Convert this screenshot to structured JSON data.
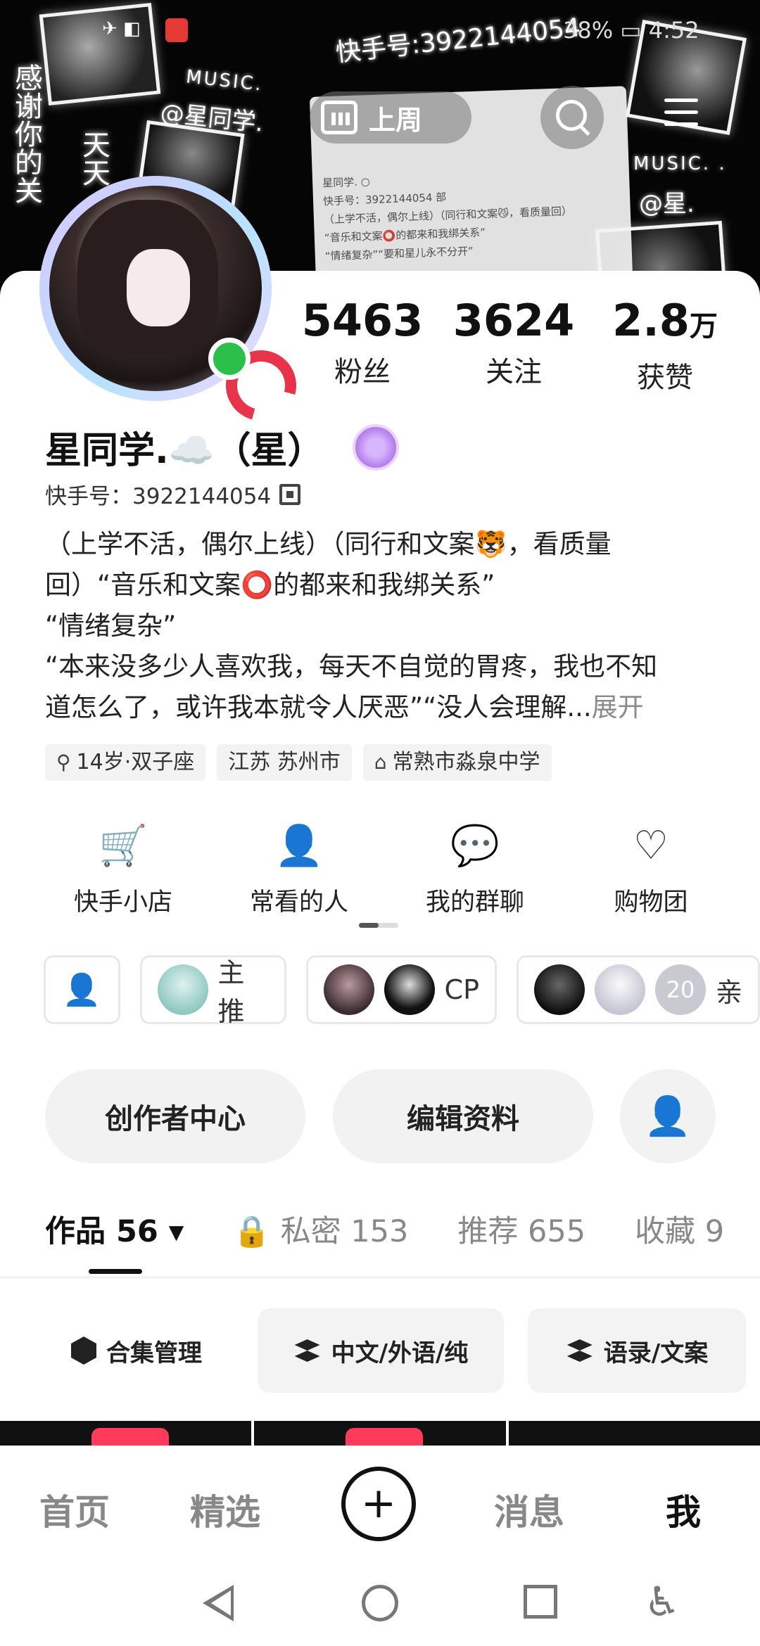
{
  "status_bar": {
    "icons_left": "✈ ◧",
    "battery_time": "38% ▭ 4:52"
  },
  "cover": {
    "vertical_left": "感谢你的关",
    "vertical_second": "天天",
    "music_left": "MUSIC.",
    "at_left": "@星同学.",
    "music_right": "MUSIC. .",
    "at_right": "@星.",
    "kuaishou_id_text": "快手号:3922144054",
    "card_lines": [
      "星同学.  ○",
      "快手号：3922144054 部",
      "（上学不活，偶尔上线）（同行和文案😼，看质量回）",
      "“音乐和文案⭕的都来和我绑关系”",
      "“情绪复杂”“要和星儿永不分开”"
    ]
  },
  "top_bar": {
    "week_label": "上周",
    "search_icon": "search-icon",
    "menu_icon": "menu-icon"
  },
  "profile": {
    "stats": [
      {
        "value": "5463",
        "unit": "",
        "label": "粉丝"
      },
      {
        "value": "3624",
        "unit": "",
        "label": "关注"
      },
      {
        "value": "2.8",
        "unit": "万",
        "label": "获赞"
      }
    ],
    "name": "星同学.☁️（星）",
    "kuaishou_id": "快手号：3922144054",
    "bio_lines": [
      "（上学不活，偶尔上线）（同行和文案🐯，看质量",
      "回）“音乐和文案⭕的都来和我绑关系”",
      "“情绪复杂”",
      "“本来没多少人喜欢我，每天不自觉的胃疼，我也不知",
      "道怎么了，或许我本就令人厌恶”“没人会理解..."
    ],
    "bio_more": "展开",
    "tags": [
      {
        "icon": "⚲",
        "text": "14岁·双子座"
      },
      {
        "icon": "",
        "text": "江苏 苏州市"
      },
      {
        "icon": "⌂",
        "text": "常熟市淼泉中学"
      }
    ]
  },
  "quick_actions": [
    {
      "icon": "🛒",
      "label": "快手小店"
    },
    {
      "icon": "👤",
      "label": "常看的人"
    },
    {
      "icon": "💬",
      "label": "我的群聊"
    },
    {
      "icon": "♡",
      "label": "购物团"
    }
  ],
  "circles": [
    {
      "label": "主推"
    },
    {
      "label": "CP"
    },
    {
      "count": "20",
      "label": "亲"
    }
  ],
  "buttons": {
    "creator_center": "创作者中心",
    "edit_profile": "编辑资料",
    "add_friend_icon": "add-user-icon"
  },
  "tabs": [
    {
      "label": "作品 56 ▾",
      "active": true
    },
    {
      "label": "🔒 私密 153",
      "active": false
    },
    {
      "label": "推荐 655",
      "active": false
    },
    {
      "label": "收藏 9",
      "active": false
    }
  ],
  "collections": {
    "manage": "合集管理",
    "items": [
      "中文/外语/纯",
      "语录/文案"
    ]
  },
  "bottom_nav": {
    "items": [
      "首页",
      "精选",
      "消息",
      "我"
    ],
    "create": "+"
  }
}
